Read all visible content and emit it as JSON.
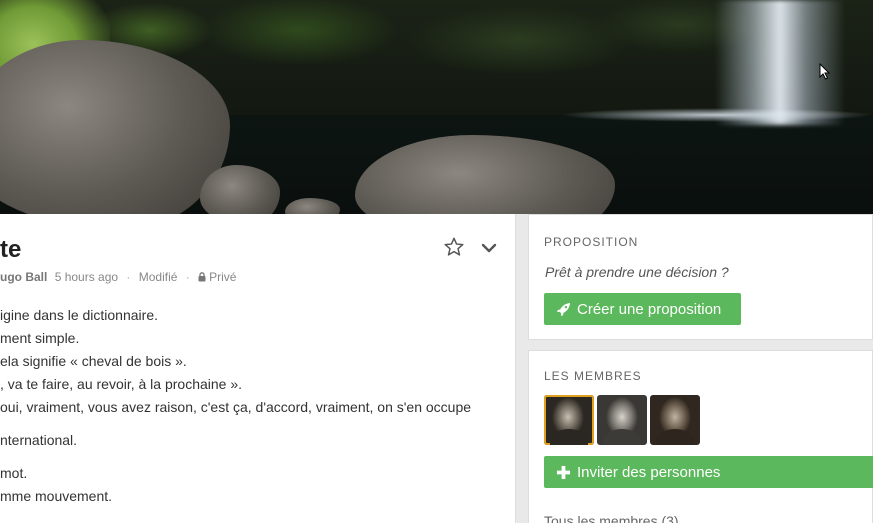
{
  "hero": {
    "description_icon": "waterfall-cover-image"
  },
  "discussion": {
    "title": "te",
    "author": "ugo Ball",
    "time": "5 hours ago",
    "edited": "Modifié",
    "privacy": "Privé",
    "lines": [
      "igine dans le dictionnaire.",
      "ment simple.",
      "ela signifie « cheval de bois ».",
      ", va te faire, au revoir, à la prochaine ».",
      "oui, vraiment, vous avez raison, c'est ça, d'accord, vraiment, on s'en occupe",
      "",
      "nternational.",
      "",
      " mot.",
      "mme mouvement."
    ]
  },
  "proposal": {
    "heading": "PROPOSITION",
    "prompt": "Prêt à prendre une décision ?",
    "button": "Créer une proposition"
  },
  "members": {
    "heading": "LES MEMBRES",
    "invite_button": "Inviter des personnes",
    "all_link": "Tous les membres (3)"
  },
  "colors": {
    "accent": "#5cb85c",
    "selected_avatar": "#e0a020"
  }
}
